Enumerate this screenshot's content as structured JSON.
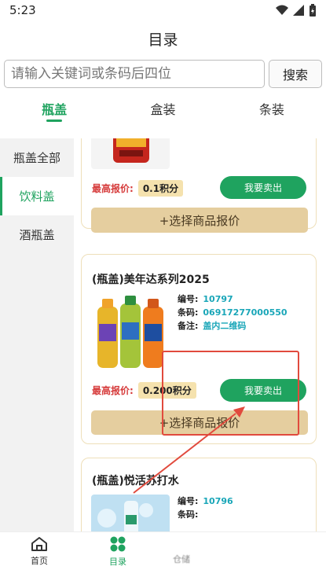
{
  "status": {
    "time": "5:23"
  },
  "header": {
    "title": "目录"
  },
  "search": {
    "placeholder": "请输入关键词或条码后四位",
    "button": "搜索"
  },
  "tabs": [
    {
      "label": "瓶盖",
      "active": true
    },
    {
      "label": "盒装",
      "active": false
    },
    {
      "label": "条装",
      "active": false
    }
  ],
  "sidebar": {
    "items": [
      {
        "label": "瓶盖全部",
        "active": false
      },
      {
        "label": "饮料盖",
        "active": true
      },
      {
        "label": "酒瓶盖",
        "active": false
      }
    ]
  },
  "cards": [
    {
      "price_label": "最高报价:",
      "price_value": "0.1积分",
      "sell_label": "我要卖出",
      "quote_label": "+选择商品报价"
    },
    {
      "title": "(瓶盖)美年达系列2025",
      "info": [
        {
          "key": "编号:",
          "value": "10797"
        },
        {
          "key": "条码:",
          "value": "06917277000550"
        },
        {
          "key": "备注:",
          "value": "盖内二维码"
        }
      ],
      "price_label": "最高报价:",
      "price_value": "0.200积分",
      "sell_label": "我要卖出",
      "quote_label": "+选择商品报价"
    },
    {
      "title": "(瓶盖)悦活苏打水",
      "info": [
        {
          "key": "编号:",
          "value": "10796"
        },
        {
          "key": "条码:",
          "value": ""
        }
      ]
    }
  ],
  "bottom_nav": {
    "home": "首页",
    "catalog": "目录",
    "blurred": "仓储"
  },
  "colors": {
    "accent": "#1fa35f",
    "annotation": "#e14a3d",
    "quote_bg": "#e5ce9f"
  }
}
